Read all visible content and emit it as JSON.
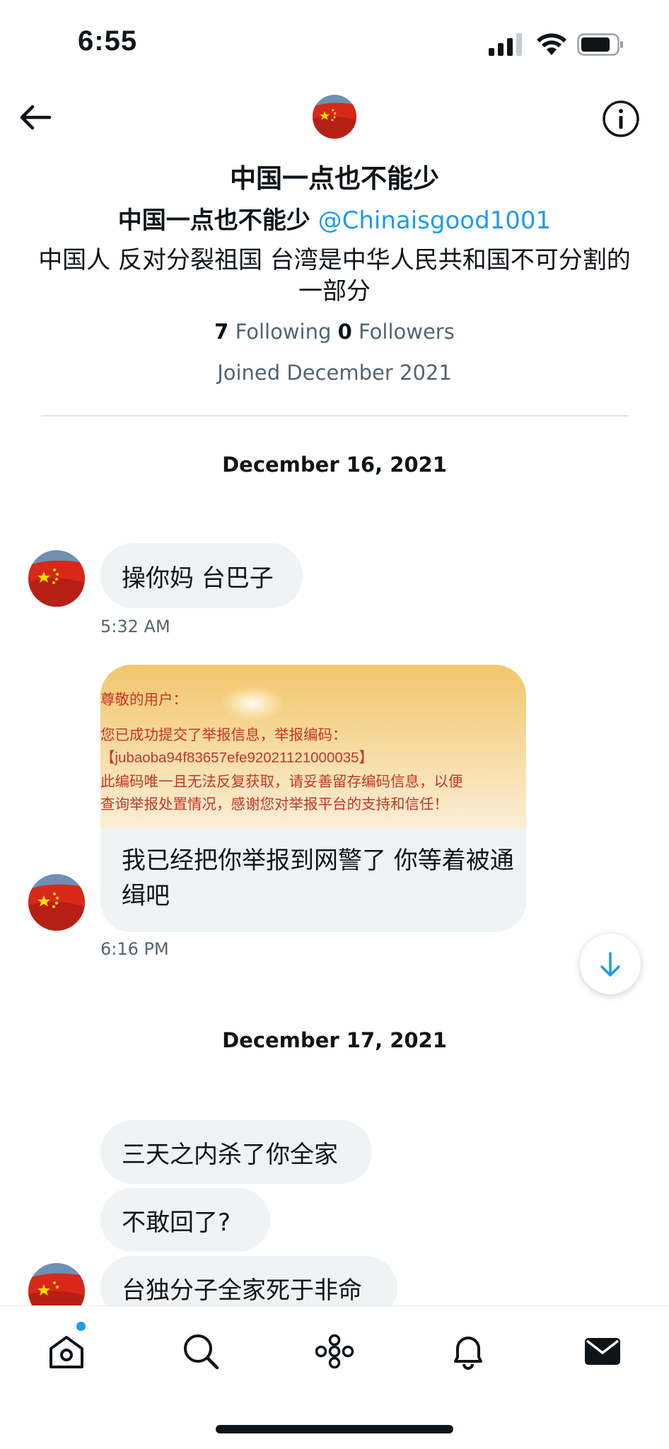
{
  "status_bar": {
    "time": "6:55",
    "battery_icon": "battery-icon",
    "wifi_icon": "wifi-icon",
    "signal_icon": "signal-icon"
  },
  "header": {
    "back_icon": "arrow-left-icon",
    "info_icon": "info-icon",
    "display_name": "中国一点也不能少",
    "name_repeat": "中国一点也不能少",
    "handle": "@Chinaisgood1001",
    "bio": "中国人 反对分裂祖国 台湾是中华人民共和国不可分割的一部分",
    "following_count": "7",
    "following_label": "Following",
    "followers_count": "0",
    "followers_label": "Followers",
    "joined": "Joined December 2021"
  },
  "conversation": {
    "date_1": "December 16, 2021",
    "msg_1": "操你妈 台巴子",
    "time_1": "5:32 AM",
    "card_lines": [
      "尊敬的用户：",
      "您已成功提交了举报信息，举报编码：",
      "【jubaoba94f83657efe92021121000035】",
      "此编码唯一且无法反复获取，请妥善留存编码信息，以便",
      "查询举报处置情况，感谢您对举报平台的支持和信任！"
    ],
    "msg_2": "我已经把你举报到网警了 你等着被通缉吧",
    "time_2": "6:16 PM",
    "date_2": "December 17, 2021",
    "msg_3": "三天之内杀了你全家",
    "msg_4": "不敢回了?",
    "msg_5": "台独分子全家死于非命"
  },
  "tabbar": {
    "items": [
      "home-icon",
      "search-icon",
      "spaces-icon",
      "notifications-icon",
      "messages-icon"
    ]
  },
  "colors": {
    "accent": "#1d9bf0",
    "bubble": "#eff3f4",
    "secondary_text": "#536471",
    "flag_red": "#de2910",
    "flag_yellow": "#ffde00",
    "report_text": "#c8352a"
  }
}
